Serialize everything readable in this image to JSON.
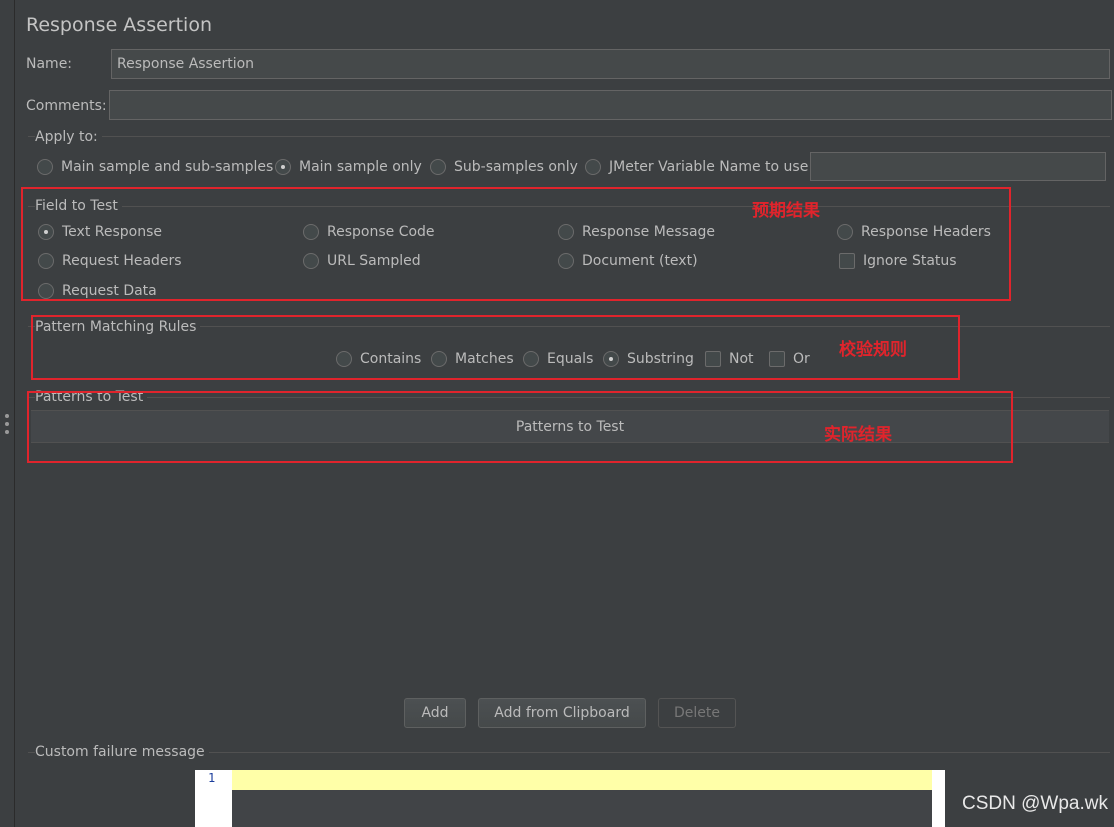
{
  "panel": {
    "title": "Response Assertion",
    "name_label": "Name:",
    "name_value": "Response Assertion",
    "comments_label": "Comments:",
    "comments_value": ""
  },
  "apply_to": {
    "legend": "Apply to:",
    "options": [
      {
        "label": "Main sample and sub-samples",
        "selected": false
      },
      {
        "label": "Main sample only",
        "selected": true
      },
      {
        "label": "Sub-samples only",
        "selected": false
      },
      {
        "label": "JMeter Variable Name to use",
        "selected": false
      }
    ],
    "variable_value": ""
  },
  "field_to_test": {
    "legend": "Field to Test",
    "annotation": "预期结果",
    "options": [
      {
        "label": "Text Response",
        "selected": true
      },
      {
        "label": "Response Code",
        "selected": false
      },
      {
        "label": "Response Message",
        "selected": false
      },
      {
        "label": "Response Headers",
        "selected": false
      },
      {
        "label": "Request Headers",
        "selected": false
      },
      {
        "label": "URL Sampled",
        "selected": false
      },
      {
        "label": "Document (text)",
        "selected": false
      },
      {
        "label": "Request Data",
        "selected": false
      }
    ],
    "ignore_status": {
      "label": "Ignore Status",
      "checked": false
    }
  },
  "pattern_matching": {
    "legend": "Pattern Matching Rules",
    "annotation": "校验规则",
    "options": [
      {
        "label": "Contains",
        "selected": false
      },
      {
        "label": "Matches",
        "selected": false
      },
      {
        "label": "Equals",
        "selected": false
      },
      {
        "label": "Substring",
        "selected": true
      }
    ],
    "not": {
      "label": "Not",
      "checked": false
    },
    "or": {
      "label": "Or",
      "checked": false
    }
  },
  "patterns": {
    "legend": "Patterns to Test",
    "column_header": "Patterns to Test",
    "annotation": "实际结果",
    "rows": []
  },
  "buttons": {
    "add": "Add",
    "add_clipboard": "Add from Clipboard",
    "delete": "Delete"
  },
  "custom_failure": {
    "legend": "Custom failure message",
    "line_number": "1",
    "content": ""
  },
  "watermark": "CSDN @Wpa.wk",
  "colors": {
    "background": "#3c3f41",
    "annotation_red": "#e0242c",
    "editor_highlight": "#ffffa8"
  }
}
